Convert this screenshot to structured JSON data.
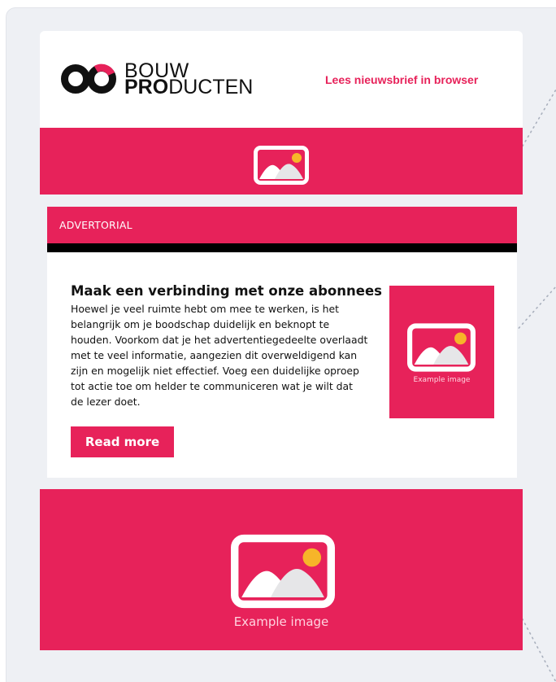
{
  "header": {
    "logo_top": "BOUW",
    "logo_bold": "PRO",
    "logo_rest": "DUCTEN",
    "browser_link": "Lees nieuwsbrief in browser"
  },
  "advertorial": {
    "label": "ADVERTORIAL",
    "title": "Maak een verbinding met onze abonnees",
    "body": "Hoewel je veel ruimte hebt om mee te werken, is het belangrijk om je boodschap duidelijk en beknopt te houden. Voorkom dat je het advertentiegedeelte overlaadt met te veel informatie, aangezien dit overweldigend kan zijn en mogelijk niet effectief. Voeg een duidelijke oproep tot actie toe om helder te communiceren wat je wilt dat de lezer doet.",
    "button_label": "Read more",
    "image_caption": "Example image"
  },
  "big_banner": {
    "image_caption": "Example image"
  },
  "icons": {
    "image_placeholder": "image-icon",
    "logo": "bouwproducten-logo"
  },
  "colors": {
    "accent": "#e7225a",
    "background": "#eef0f4",
    "text": "#111111",
    "divider": "#000000"
  }
}
